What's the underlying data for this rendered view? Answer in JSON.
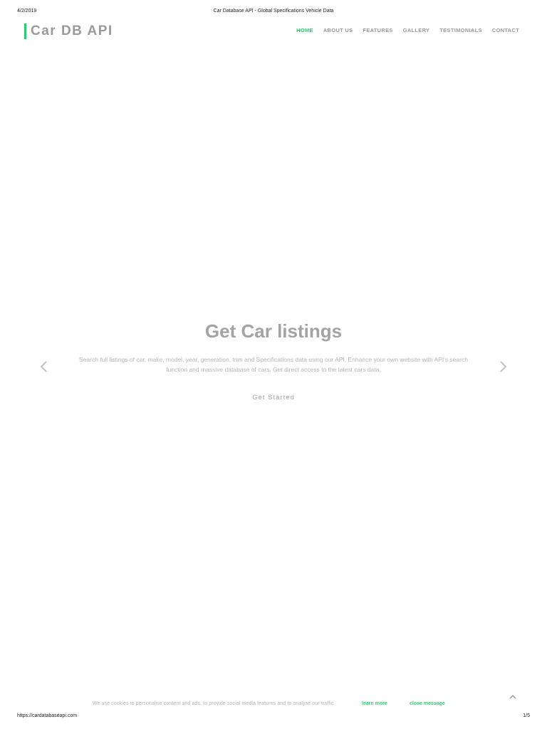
{
  "print_header": {
    "date": "4/2/2019",
    "title": "Car Database API - Global Specifications Vehicle Data"
  },
  "brand": {
    "name": "Car DB API",
    "accent_color": "#2ecc71"
  },
  "nav": {
    "items": [
      {
        "label": "HOME",
        "active": true
      },
      {
        "label": "ABOUT US",
        "active": false
      },
      {
        "label": "FEATURES",
        "active": false
      },
      {
        "label": "GALLERY",
        "active": false
      },
      {
        "label": "TESTIMONIALS",
        "active": false
      },
      {
        "label": "CONTACT",
        "active": false
      }
    ]
  },
  "hero": {
    "title": "Get Car listings",
    "description": "Search full listings of car, make, model, year, generation, trim and Specifications data using our API. Enhance your own website with API's search function and massive database of cars. Get direct access to the latest cars data.",
    "cta_label": "Get Started",
    "prev_icon": "chevron-left-icon",
    "next_icon": "chevron-right-icon"
  },
  "scroll_top_icon": "chevron-up-icon",
  "cookie": {
    "text": "We use cookies to personalise content and ads, to provide social media features and to analyse our traffic.",
    "learn_more": "learn more",
    "close": "close message"
  },
  "print_footer": {
    "url": "https://cardatabaseapi.com",
    "page": "1/5"
  }
}
